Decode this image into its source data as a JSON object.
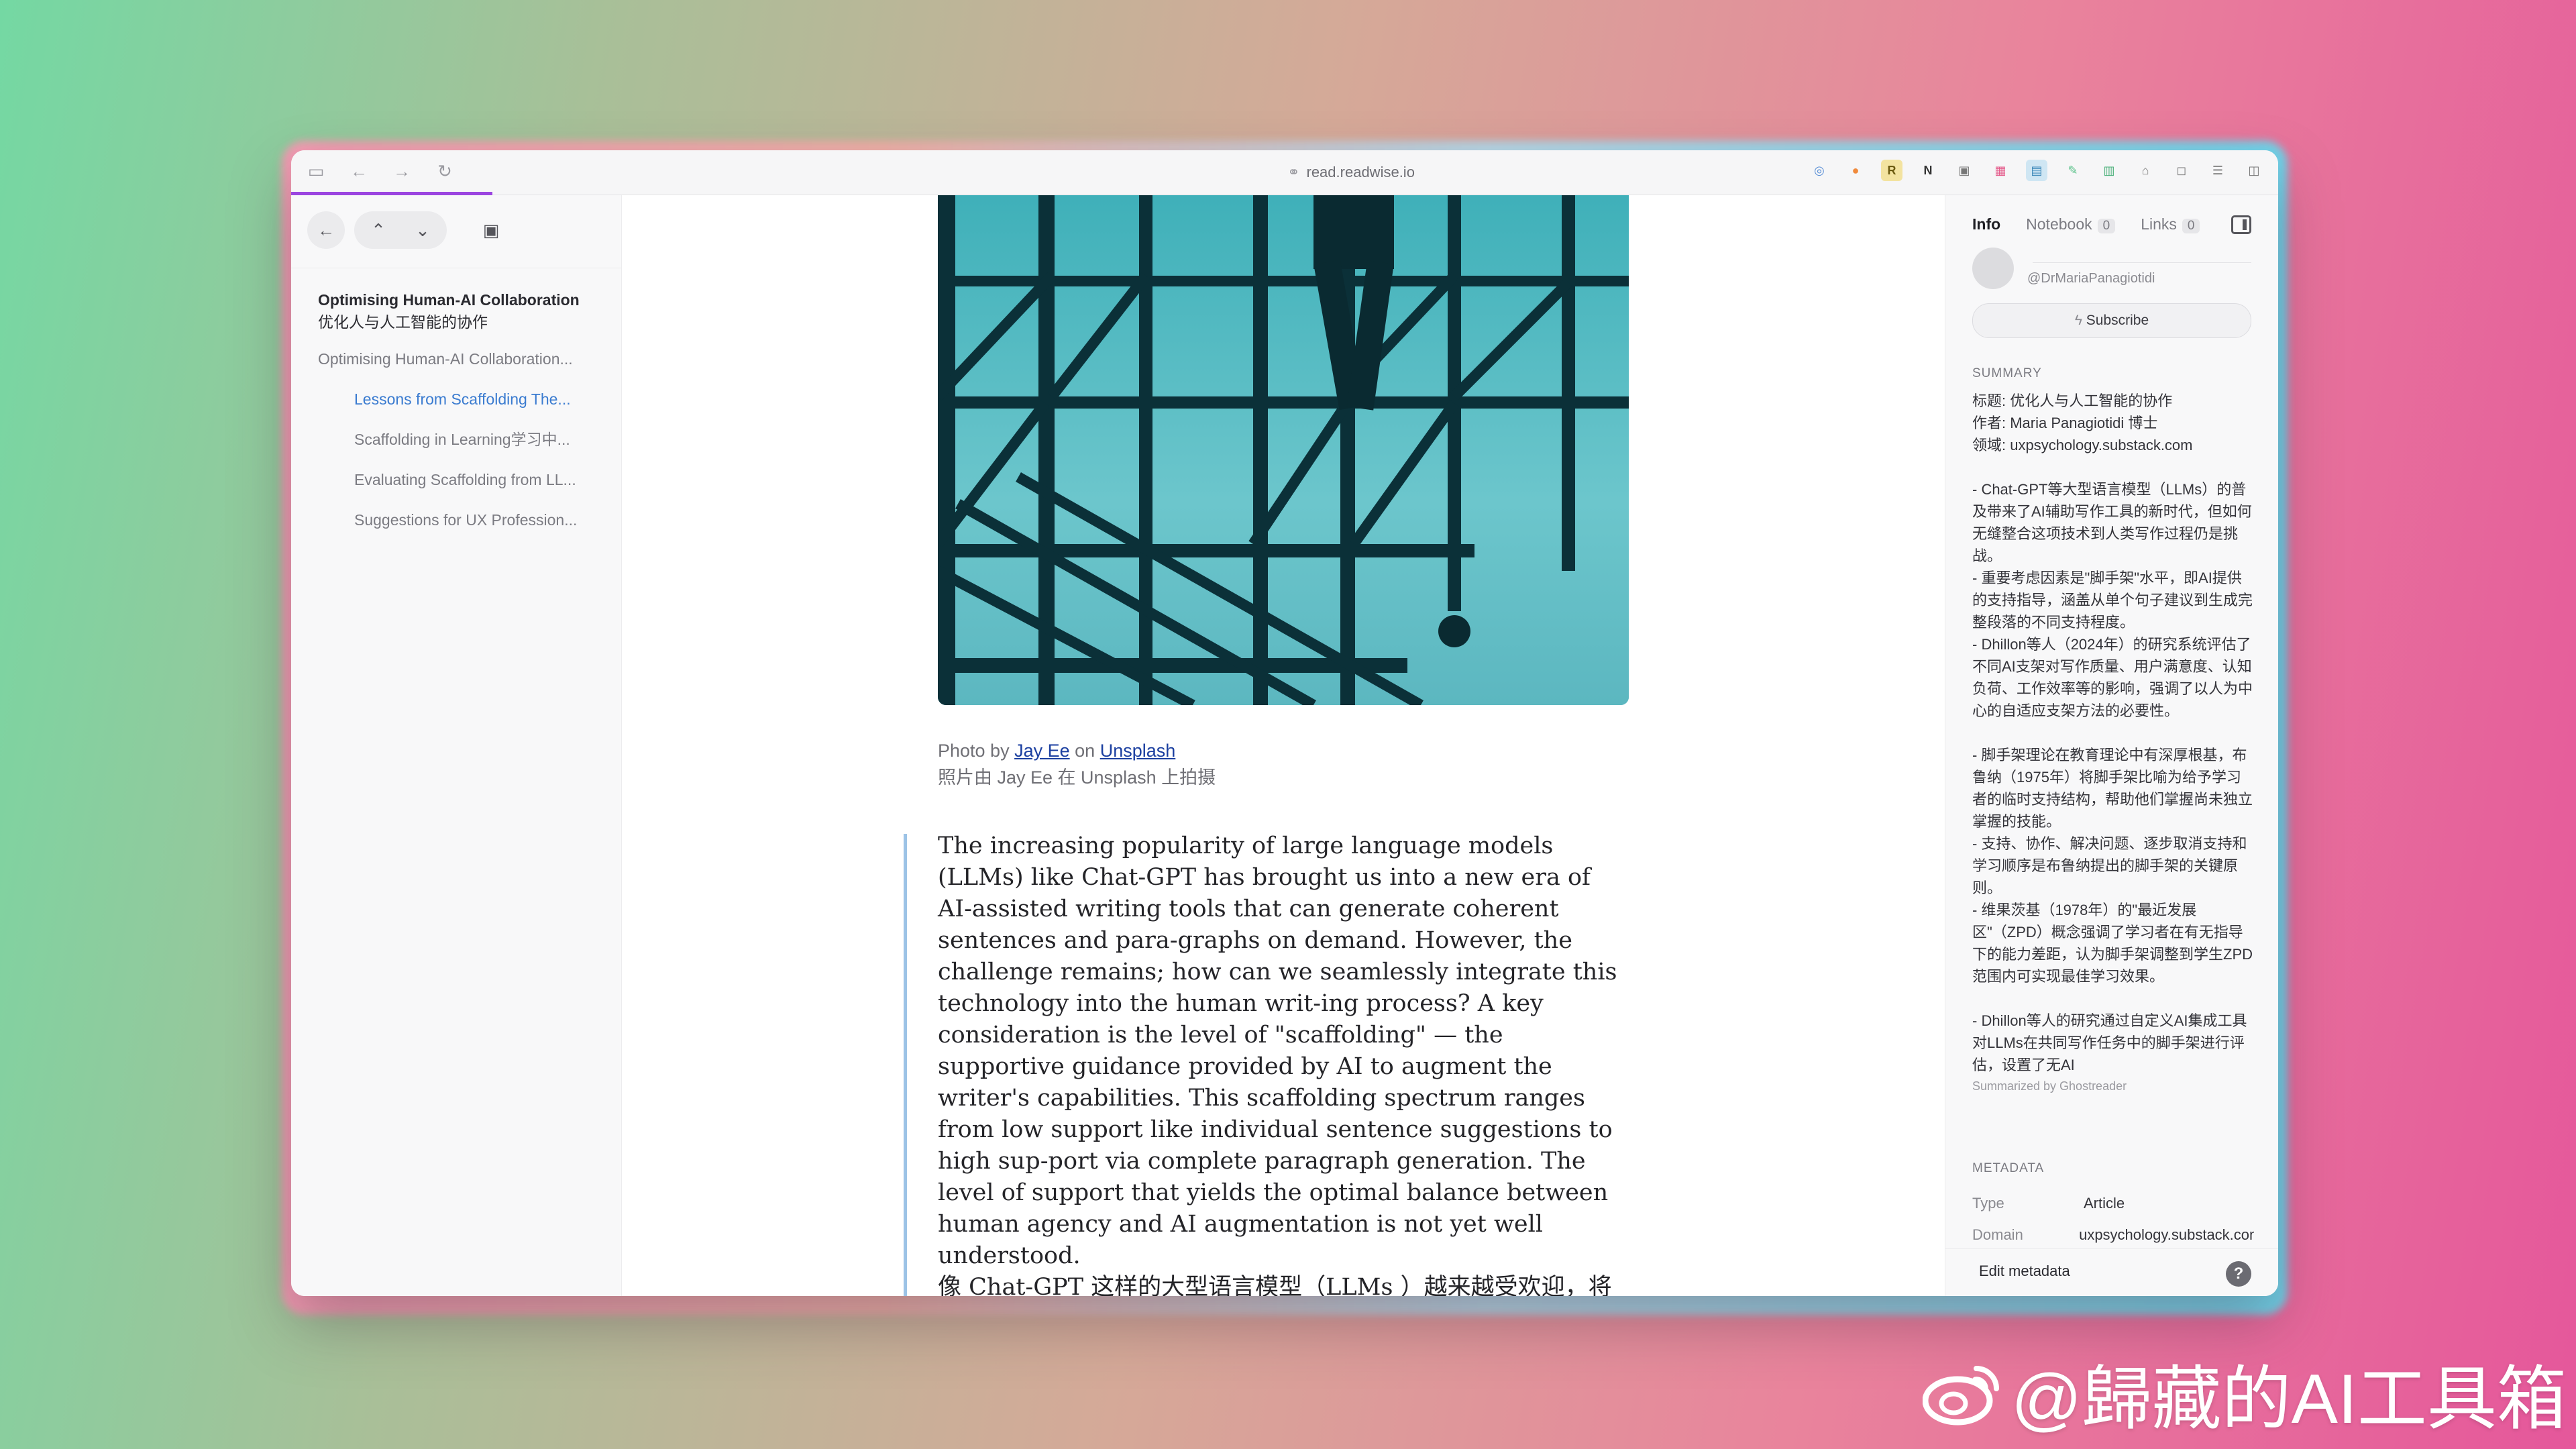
{
  "browser": {
    "url": "read.readwise.io",
    "icons": [
      "sidebar-toggle-icon",
      "back-arrow-icon",
      "forward-arrow-icon",
      "reload-icon"
    ],
    "extensions": [
      "translate-icon",
      "extension-orange-icon",
      "readwise-r-icon",
      "notion-icon",
      "extension-icon",
      "extension-pink-icon",
      "extension-teal-icon",
      "pen-icon",
      "bookmark-icon",
      "lock-icon",
      "chat-icon",
      "reader-icon",
      "split-view-icon"
    ],
    "progress_color": "#9b45e0"
  },
  "sidebar": {
    "toc_title": "Optimising Human-AI Collaboration",
    "toc_subtitle": "优化人与人工智能的协作",
    "items": [
      {
        "label": "Optimising Human-AI Collaboration...",
        "level": 1,
        "active": false
      },
      {
        "label": "Lessons from Scaffolding The...",
        "level": 2,
        "active": true
      },
      {
        "label": "Scaffolding in Learning学习中...",
        "level": 2,
        "active": false
      },
      {
        "label": "Evaluating Scaffolding from LL...",
        "level": 2,
        "active": false
      },
      {
        "label": "Suggestions for UX Profession...",
        "level": 2,
        "active": false
      }
    ]
  },
  "article": {
    "caption_prefix": "Photo by",
    "caption_author": "Jay Ee",
    "caption_on": "on",
    "caption_source": "Unsplash",
    "caption_cn": "照片由 Jay Ee 在 Unsplash 上拍摄",
    "paragraph_en": "The increasing popularity of large language models (LLMs) like Chat-GPT has brought us into a new era of AI-assisted writing tools that can generate coherent sentences and para-graphs on demand. However, the challenge remains; how can we seamlessly integrate this technology into the human writ-ing process? A key consideration is the level of \"scaffolding\" — the supportive guidance provided by AI to augment the writer's capabilities. This scaffolding spectrum ranges from low support like individual sentence suggestions to high sup-port via complete paragraph generation. The level of support that yields the optimal balance between human agency and AI augmentation is not yet well understood.",
    "paragraph_cn": "像 Chat-GPT 这样的大型语言模型（LLMs ）越来越受欢迎，将我们带入了一个人工智能辅助写作工具的新时代，这些工具可以按需生成连贯的句子和段落。然而，挑战依然存在：我们如何才能将这项技术"
  },
  "panel": {
    "tabs": [
      {
        "label": "Info",
        "count": null,
        "active": true
      },
      {
        "label": "Notebook",
        "count": "0",
        "active": false
      },
      {
        "label": "Links",
        "count": "0",
        "active": false
      }
    ],
    "author_handle": "@DrMariaPanagiotidi",
    "subscribe_label": "Subscribe",
    "summary_heading": "SUMMARY",
    "summary": [
      "标题: 优化人与人工智能的协作",
      "作者: Maria Panagiotidi 博士",
      "领域: uxpsychology.substack.com",
      "",
      "- Chat-GPT等大型语言模型（LLMs）的普及带来了AI辅助写作工具的新时代，但如何无缝整合这项技术到人类写作过程仍是挑战。",
      "- 重要考虑因素是\"脚手架\"水平，即AI提供的支持指导，涵盖从单个句子建议到生成完整段落的不同支持程度。",
      "- Dhillon等人（2024年）的研究系统评估了不同AI支架对写作质量、用户满意度、认知负荷、工作效率等的影响，强调了以人为中心的自适应支架方法的必要性。",
      "",
      "- 脚手架理论在教育理论中有深厚根基，布鲁纳（1975年）将脚手架比喻为给予学习者的临时支持结构，帮助他们掌握尚未独立掌握的技能。",
      "- 支持、协作、解决问题、逐步取消支持和学习顺序是布鲁纳提出的脚手架的关键原则。",
      "- 维果茨基（1978年）的\"最近发展区\"（ZPD）概念强调了学习者在有无指导下的能力差距，认为脚手架调整到学生ZPD范围内可实现最佳学习效果。",
      "",
      "- Dhillon等人的研究通过自定义AI集成工具对LLMs在共同写作任务中的脚手架进行评估，设置了无AI"
    ],
    "summarized_by": "Summarized by Ghostreader",
    "metadata_heading": "METADATA",
    "metadata": [
      {
        "key": "Type",
        "value": "Article"
      },
      {
        "key": "Domain",
        "value": "uxpsychology.substack.com"
      }
    ],
    "edit_metadata_label": "Edit metadata",
    "help_label": "?"
  },
  "watermark": {
    "text": "@歸藏的AI工具箱"
  }
}
